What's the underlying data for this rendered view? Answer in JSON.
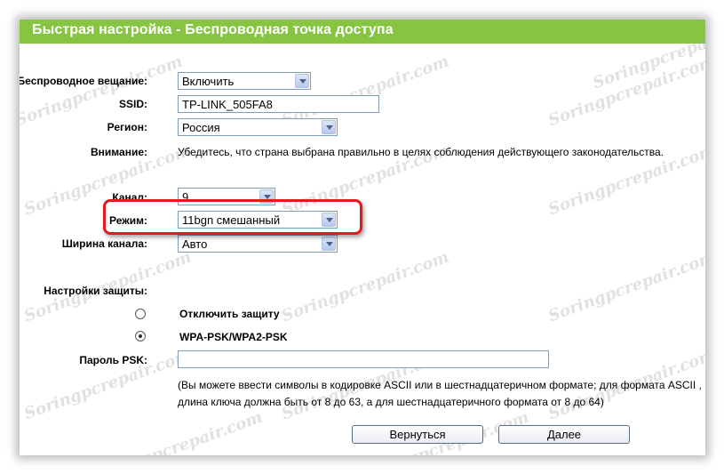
{
  "header": {
    "title": "Быстрая настройка - Беспроводная точка доступа"
  },
  "watermark": "Soringpcrepair.com",
  "form": {
    "broadcast": {
      "label": "Беспроводное вещание:",
      "value": "Включить"
    },
    "ssid": {
      "label": "SSID:",
      "value": "TP-LINK_505FA8"
    },
    "region": {
      "label": "Регион:",
      "value": "Россия"
    },
    "warning": {
      "label": "Внимание:",
      "text": "Убедитесь, что страна выбрана правильно в целях соблюдения действующего законодательства."
    },
    "channel": {
      "label": "Канал:",
      "value": "9"
    },
    "mode": {
      "label": "Режим:",
      "value": "11bgn смешанный"
    },
    "width": {
      "label": "Ширина канала:",
      "value": "Авто"
    },
    "security": {
      "label": "Настройки защиты:",
      "options": [
        {
          "label": "Отключить защиту",
          "checked": false
        },
        {
          "label": "WPA-PSK/WPA2-PSK",
          "checked": true
        }
      ]
    },
    "psk": {
      "label": "Пароль PSK:",
      "value": "",
      "hint_line1": "(Вы можете ввести символы в кодировке ASCII или в шестнадцатеричном формате; для формата ASCII ,",
      "hint_line2": "длина ключа должна быть от 8 до 63, а для шестнадцатеричного формата от 8 до 64)"
    }
  },
  "buttons": {
    "back": "Вернуться",
    "next": "Далее"
  },
  "colors": {
    "header": "#86c442",
    "highlight": "#e11b1b"
  }
}
